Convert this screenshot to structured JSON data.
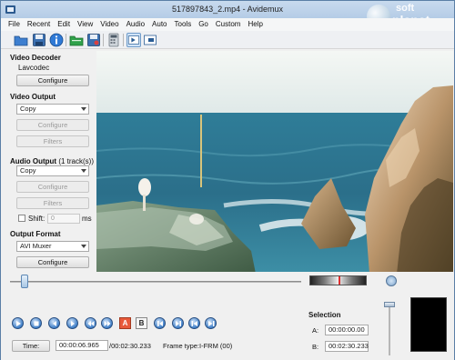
{
  "window": {
    "title": "517897843_2.mp4 - Avidemux"
  },
  "watermark": {
    "line1": "soft",
    "line2": "planet"
  },
  "menu": [
    "File",
    "Recent",
    "Edit",
    "View",
    "Video",
    "Audio",
    "Auto",
    "Tools",
    "Go",
    "Custom",
    "Help"
  ],
  "toolbar": {
    "icons": [
      "open-file-icon",
      "save-icon",
      "info-icon",
      "open-folder-icon",
      "save-video-icon",
      "calculator-icon",
      "play-filtered-icon",
      "output-icon"
    ]
  },
  "video_decoder": {
    "title": "Video Decoder",
    "codec": "Lavcodec",
    "configure": "Configure"
  },
  "video_output": {
    "title": "Video Output",
    "selected": "Copy",
    "configure": "Configure",
    "filters": "Filters"
  },
  "audio_output": {
    "title": "Audio Output",
    "tracks": "(1 track(s))",
    "selected": "Copy",
    "configure": "Configure",
    "filters": "Filters",
    "shift_label": "Shift:",
    "shift_value": "0",
    "shift_unit": "ms"
  },
  "output_format": {
    "title": "Output Format",
    "selected": "AVI Muxer",
    "configure": "Configure"
  },
  "playback": {
    "position_fraction": 0.05,
    "time_button": "Time:",
    "current_time": "00:00:06.965",
    "total_time": "/00:02:30.233",
    "frame_type_label": "Frame type:",
    "frame_type_value": "I-FRM (00)",
    "marker_a": "A",
    "marker_b": "B"
  },
  "selection": {
    "title": "Selection",
    "a_label": "A:",
    "a_value": "00:00:00.00",
    "b_label": "B:",
    "b_value": "00:02:30.233"
  },
  "colors": {
    "accent": "#3f7fc8",
    "titlebar": "#b9cfe8"
  }
}
